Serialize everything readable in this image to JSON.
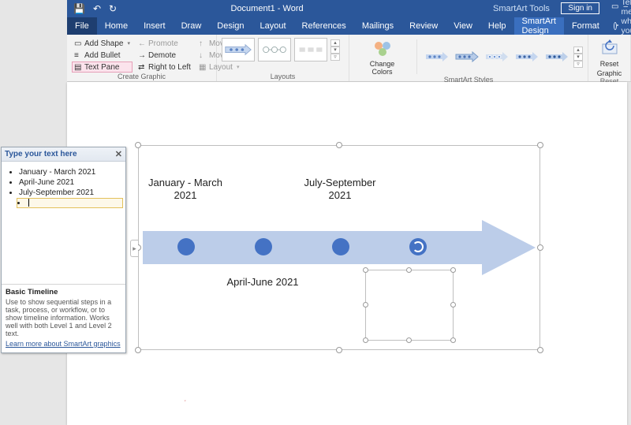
{
  "qat": {
    "save": "💾",
    "undo": "↶",
    "redo": "↻"
  },
  "title": {
    "document": "Document1 - Word",
    "tools": "SmartArt Tools",
    "signin": "Sign in"
  },
  "tabs": {
    "file": "File",
    "home": "Home",
    "insert": "Insert",
    "draw": "Draw",
    "design": "Design",
    "layout": "Layout",
    "references": "References",
    "mailings": "Mailings",
    "review": "Review",
    "view": "View",
    "help": "Help",
    "sa_design": "SmartArt Design",
    "format": "Format",
    "tellme": "Tell me what you want to do"
  },
  "ribbon": {
    "create": {
      "add_shape": "Add Shape",
      "add_bullet": "Add Bullet",
      "text_pane": "Text Pane",
      "promote": "Promote",
      "demote": "Demote",
      "rtl": "Right to Left",
      "move_up": "Move Up",
      "move_down": "Move Down",
      "layout": "Layout",
      "group": "Create Graphic"
    },
    "layouts": {
      "group": "Layouts"
    },
    "colors": {
      "label": "Change Colors"
    },
    "styles": {
      "group": "SmartArt Styles"
    },
    "reset": {
      "label1": "Reset",
      "label2": "Graphic",
      "group": "Reset"
    }
  },
  "textpane": {
    "title": "Type your text here",
    "items": [
      "January - March 2021",
      "April-June 2021",
      "July-September 2021"
    ],
    "footer_title": "Basic Timeline",
    "footer_body": "Use to show sequential steps in a task, process, or workflow, or to show timeline information. Works well with both Level 1 and Level 2 text.",
    "footer_link": "Learn more about SmartArt graphics"
  },
  "smartart": {
    "label1": "January - March 2021",
    "label2": "April-June 2021",
    "label3": "July-September 2021"
  },
  "chart_data": {
    "type": "timeline",
    "title": "Basic Timeline",
    "points": [
      {
        "index": 1,
        "label": "January - March 2021",
        "label_position": "above"
      },
      {
        "index": 2,
        "label": "April-June 2021",
        "label_position": "below"
      },
      {
        "index": 3,
        "label": "July-September 2021",
        "label_position": "above"
      },
      {
        "index": 4,
        "label": "",
        "label_position": "below",
        "editing": true
      }
    ]
  }
}
